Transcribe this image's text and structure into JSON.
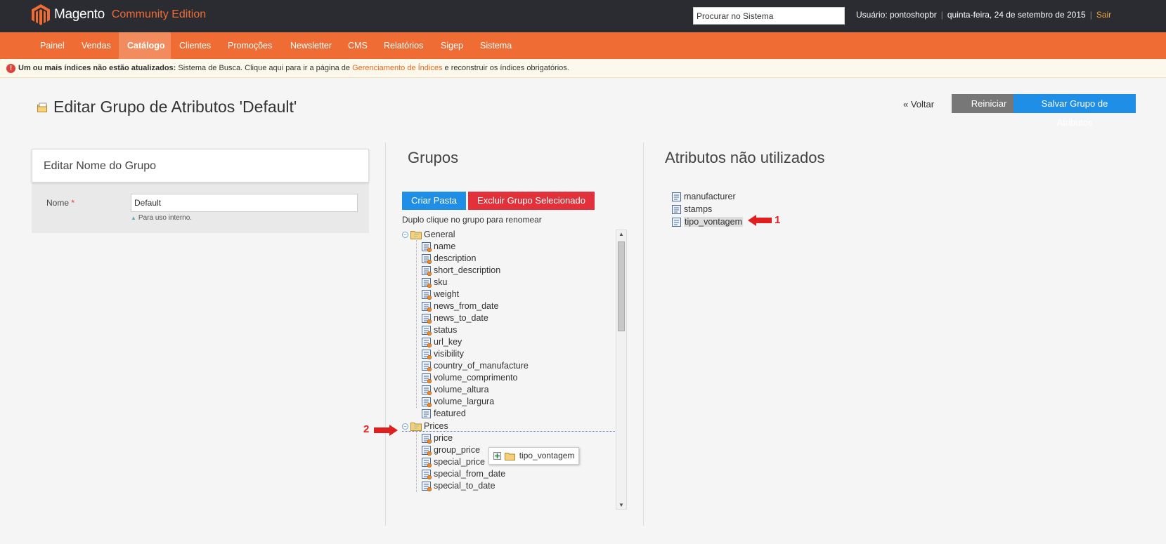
{
  "header": {
    "brand": "Magento",
    "edition": "Community Edition",
    "search_placeholder": "Procurar no Sistema",
    "user": "Usuário: pontoshopbr",
    "date": "quinta-feira, 24 de setembro de 2015",
    "logout": "Sair"
  },
  "nav": {
    "items": [
      {
        "label": "Painel"
      },
      {
        "label": "Vendas"
      },
      {
        "label": "Catálogo"
      },
      {
        "label": "Clientes"
      },
      {
        "label": "Promoções"
      },
      {
        "label": "Newsletter"
      },
      {
        "label": "CMS"
      },
      {
        "label": "Relatórios"
      },
      {
        "label": "Sigep"
      },
      {
        "label": "Sistema"
      }
    ],
    "active": "Catálogo"
  },
  "notice": {
    "bold": "Um ou mais índices não estão atualizados:",
    "text1": " Sistema de Busca. Clique aqui para ir a página de ",
    "link": "Gerenciamento de Índices",
    "text2": " e reconstruir os índices obrigatórios."
  },
  "page": {
    "title": "Editar Grupo de Atributos 'Default'",
    "back": "« Voltar",
    "reset": "Reiniciar",
    "save": "Salvar Grupo de Atributos"
  },
  "edit_name": {
    "heading": "Editar Nome do Grupo",
    "label": "Nome",
    "required": "*",
    "value": "Default",
    "note": "Para uso interno."
  },
  "groups": {
    "title": "Grupos",
    "create": "Criar Pasta",
    "delete": "Excluir Grupo Selecionado",
    "hint": "Duplo clique no grupo para renomear",
    "tree": [
      {
        "type": "folder",
        "label": "General"
      },
      {
        "type": "attr",
        "label": "name"
      },
      {
        "type": "attr",
        "label": "description"
      },
      {
        "type": "attr",
        "label": "short_description"
      },
      {
        "type": "attr",
        "label": "sku"
      },
      {
        "type": "attr",
        "label": "weight"
      },
      {
        "type": "attr",
        "label": "news_from_date"
      },
      {
        "type": "attr",
        "label": "news_to_date"
      },
      {
        "type": "attr",
        "label": "status"
      },
      {
        "type": "attr",
        "label": "url_key"
      },
      {
        "type": "attr",
        "label": "visibility"
      },
      {
        "type": "attr",
        "label": "country_of_manufacture"
      },
      {
        "type": "attr",
        "label": "volume_comprimento"
      },
      {
        "type": "attr",
        "label": "volume_altura"
      },
      {
        "type": "attr",
        "label": "volume_largura"
      },
      {
        "type": "attr-plain",
        "label": "featured"
      },
      {
        "type": "folder",
        "label": "Prices"
      },
      {
        "type": "attr",
        "label": "price"
      },
      {
        "type": "attr",
        "label": "group_price"
      },
      {
        "type": "attr",
        "label": "special_price"
      },
      {
        "type": "attr",
        "label": "special_from_date"
      },
      {
        "type": "attr",
        "label": "special_to_date"
      }
    ],
    "drag_ghost": "tipo_vontagem"
  },
  "unused": {
    "title": "Atributos não utilizados",
    "items": [
      {
        "label": "manufacturer"
      },
      {
        "label": "stamps"
      },
      {
        "label": "tipo_vontagem"
      }
    ]
  },
  "annotations": {
    "one": "1",
    "two": "2",
    "color": "#e02020"
  },
  "colors": {
    "header_bg": "#2a2c31",
    "nav_bg": "#ef6c35",
    "primary_button": "#1e8ee6",
    "danger_button": "#e2313a"
  }
}
